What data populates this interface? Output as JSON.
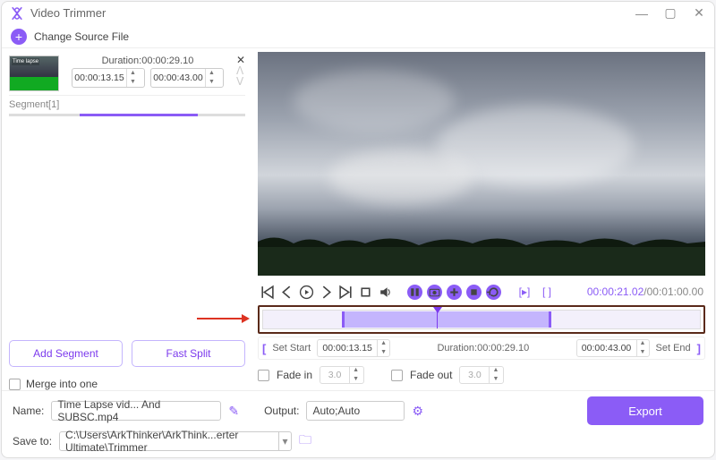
{
  "window": {
    "title": "Video Trimmer"
  },
  "actions": {
    "change_source": "Change Source File"
  },
  "segment": {
    "duration_label": "Duration:00:00:29.10",
    "start_value": "00:00:13.15",
    "end_value": "00:00:43.00",
    "seg_name": "Segment[1]"
  },
  "buttons": {
    "add_segment": "Add Segment",
    "fast_split": "Fast Split",
    "merge": "Merge into one",
    "export": "Export"
  },
  "player_time": {
    "current": "00:00:21.02",
    "total": "/00:01:00.00"
  },
  "range": {
    "set_start": "Set Start",
    "start": "00:00:13.15",
    "dur": "Duration:00:00:29.10",
    "end": "00:00:43.00",
    "set_end": "Set End"
  },
  "fade": {
    "in_label": "Fade in",
    "in_value": "3.0",
    "out_label": "Fade out",
    "out_value": "3.0"
  },
  "bottom": {
    "name_label": "Name:",
    "name_value": "Time Lapse vid... And SUBSC.mp4",
    "output_label": "Output:",
    "output_value": "Auto;Auto",
    "saveto_label": "Save to:",
    "saveto_value": "C:\\Users\\ArkThinker\\ArkThink...erter Ultimate\\Trimmer"
  }
}
